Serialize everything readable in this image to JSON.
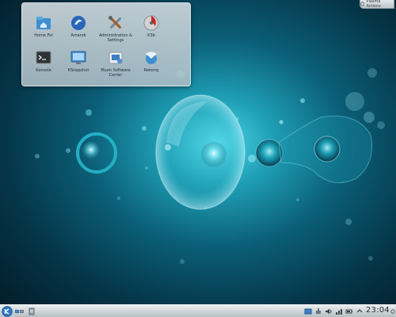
{
  "desktop": {
    "folder_items": [
      {
        "label": "Home Fol",
        "icon": "home-folder-icon"
      },
      {
        "label": "Amarok",
        "icon": "amarok-icon"
      },
      {
        "label": "Administration & Settings",
        "icon": "settings-tools-icon"
      },
      {
        "label": "K3b",
        "icon": "k3b-icon"
      },
      {
        "label": "Konsole",
        "icon": "terminal-icon"
      },
      {
        "label": "KSnapshot",
        "icon": "screenshot-icon"
      },
      {
        "label": "Muon Software Center",
        "icon": "software-center-icon"
      },
      {
        "label": "Rekonq",
        "icon": "rekonq-browser-icon"
      }
    ]
  },
  "toolbox": {
    "label": "Plasma Actions"
  },
  "panel": {
    "clock": "23:04",
    "tray_icons": [
      "window-icon",
      "notifications-icon",
      "volume-icon",
      "network-icon",
      "battery-icon",
      "expand-icon"
    ]
  },
  "colors": {
    "wallpaper_center": "#4fd6e6",
    "wallpaper_edge": "#021a26",
    "panel": "#cdd4d8"
  }
}
